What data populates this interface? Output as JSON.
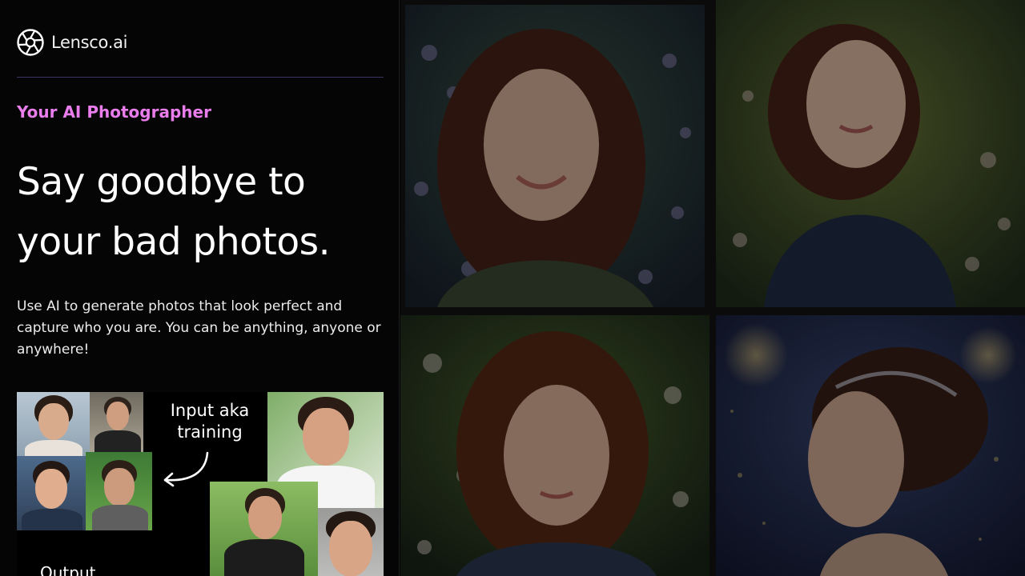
{
  "brand": {
    "name": "Lensco.ai",
    "logo_icon": "aperture-icon"
  },
  "hero": {
    "eyebrow": "Your AI Photographer",
    "headline_line1": "Say goodbye to",
    "headline_line2": "your bad photos.",
    "description": "Use AI to generate photos that look perfect and capture who you are. You can be anything, anyone or anywhere!"
  },
  "demo": {
    "input_label_line1": "Input aka",
    "input_label_line2": "training",
    "output_label": "Output",
    "arrow_icon": "curved-arrow-left-icon"
  },
  "gallery": {
    "images": [
      "portrait-woman-flowers",
      "portrait-woman-garden",
      "portrait-woman-blossoms",
      "portrait-woman-starry"
    ]
  },
  "colors": {
    "accent": "#e97dec",
    "background": "#050505",
    "divider": "#3a3565",
    "text": "#ffffff"
  }
}
